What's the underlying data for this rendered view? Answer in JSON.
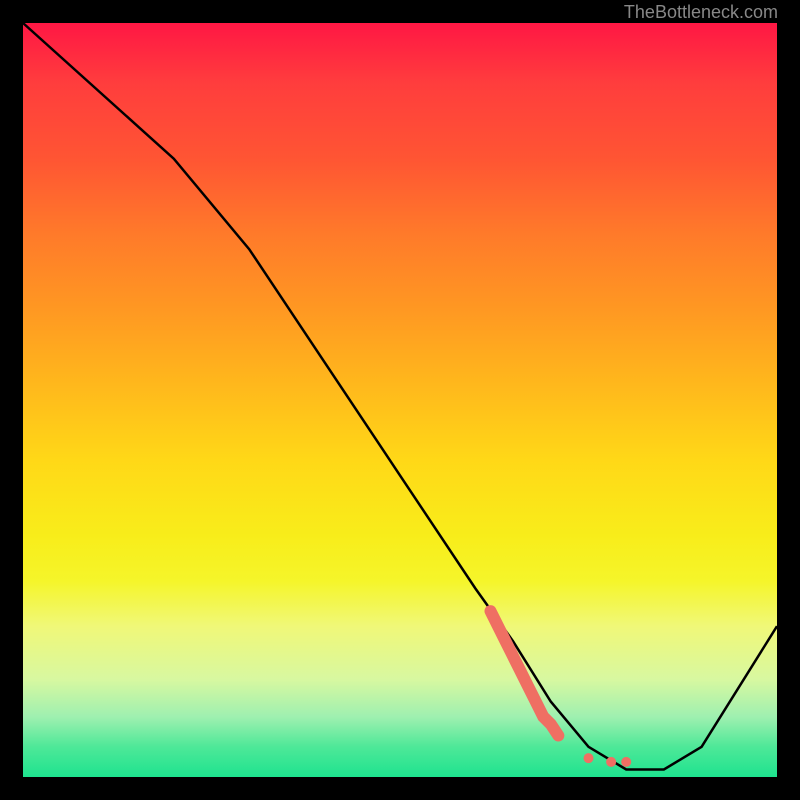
{
  "watermark": "TheBottleneck.com",
  "chart_data": {
    "type": "line",
    "title": "",
    "xlabel": "",
    "ylabel": "",
    "xlim": [
      0,
      100
    ],
    "ylim": [
      0,
      100
    ],
    "series": [
      {
        "name": "bottleneck-curve",
        "color": "#000000",
        "x": [
          0,
          20,
          30,
          40,
          50,
          60,
          65,
          70,
          75,
          80,
          85,
          90,
          100
        ],
        "y": [
          100,
          82,
          70,
          55,
          40,
          25,
          18,
          10,
          4,
          1,
          1,
          4,
          20
        ]
      }
    ],
    "highlight": {
      "name": "highlight-segment",
      "color": "#ef6f63",
      "points": [
        {
          "x": 62,
          "y": 22
        },
        {
          "x": 63,
          "y": 20
        },
        {
          "x": 64,
          "y": 18
        },
        {
          "x": 65,
          "y": 16
        },
        {
          "x": 66,
          "y": 14
        },
        {
          "x": 67,
          "y": 12
        },
        {
          "x": 68,
          "y": 10
        },
        {
          "x": 69,
          "y": 8
        },
        {
          "x": 70,
          "y": 7
        },
        {
          "x": 71,
          "y": 5.5
        },
        {
          "x": 75,
          "y": 2.5
        },
        {
          "x": 78,
          "y": 2
        },
        {
          "x": 80,
          "y": 2
        }
      ]
    }
  }
}
